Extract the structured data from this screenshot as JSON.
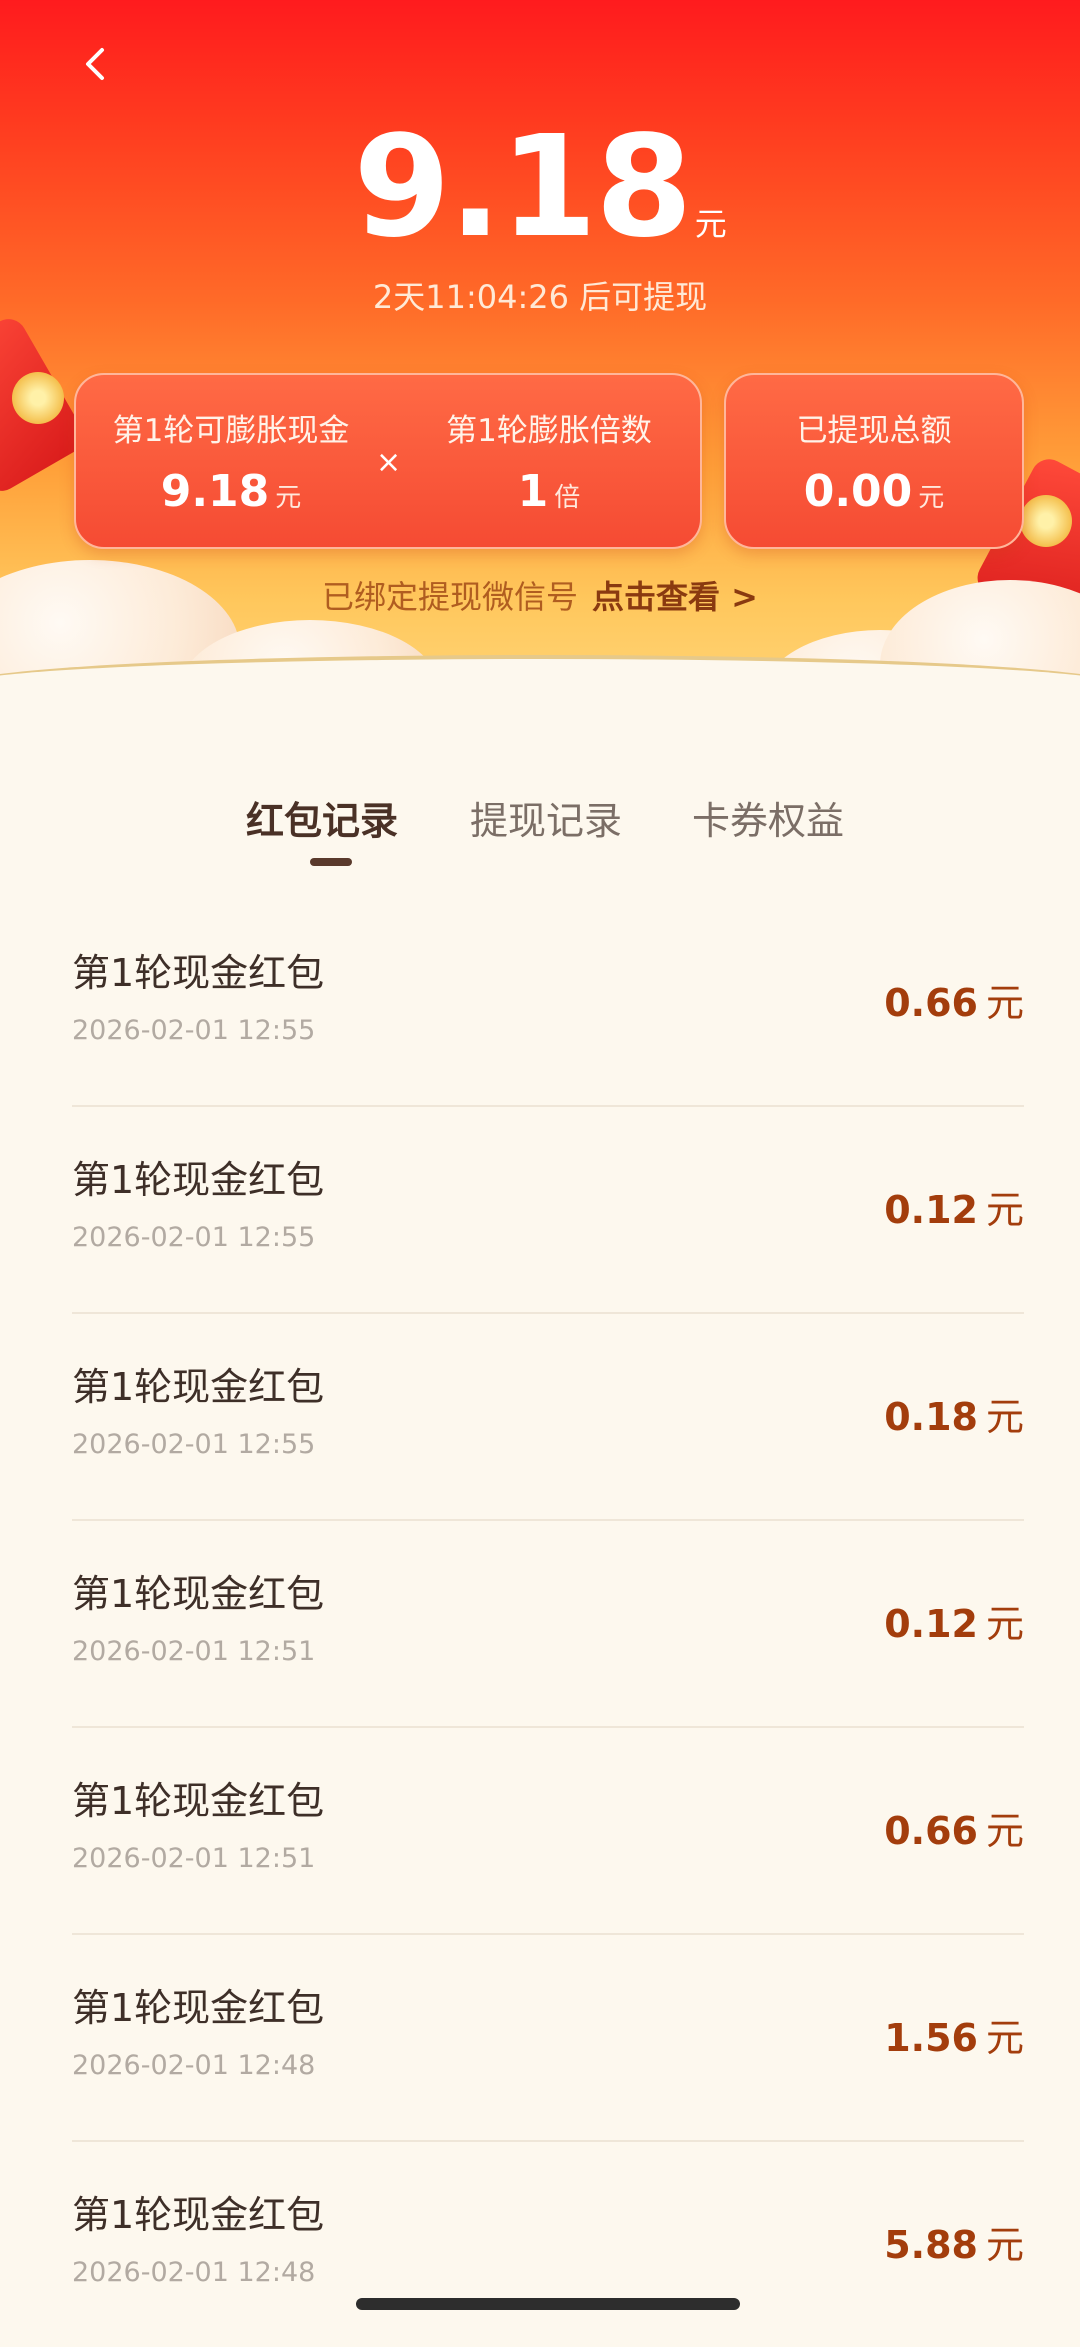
{
  "header": {
    "back_label": "返回",
    "amount": "9.18",
    "amount_unit": "元",
    "countdown": "2天11:04:26 后可提现",
    "round_cash": {
      "label": "第1轮可膨胀现金",
      "value": "9.18",
      "unit": "元"
    },
    "multiply_symbol": "×",
    "multiplier": {
      "label": "第1轮膨胀倍数",
      "value": "1",
      "unit": "倍"
    },
    "withdrawn": {
      "label": "已提现总额",
      "value": "0.00",
      "unit": "元"
    },
    "wechat_text": "已绑定提现微信号",
    "wechat_link": "点击查看 >"
  },
  "tabs": [
    {
      "label": "红包记录",
      "active": true
    },
    {
      "label": "提现记录",
      "active": false
    },
    {
      "label": "卡券权益",
      "active": false
    }
  ],
  "records": [
    {
      "title": "第1轮现金红包",
      "time": "2026-02-01 12:55",
      "amount": "0.66",
      "unit": "元"
    },
    {
      "title": "第1轮现金红包",
      "time": "2026-02-01 12:55",
      "amount": "0.12",
      "unit": "元"
    },
    {
      "title": "第1轮现金红包",
      "time": "2026-02-01 12:55",
      "amount": "0.18",
      "unit": "元"
    },
    {
      "title": "第1轮现金红包",
      "time": "2026-02-01 12:51",
      "amount": "0.12",
      "unit": "元"
    },
    {
      "title": "第1轮现金红包",
      "time": "2026-02-01 12:51",
      "amount": "0.66",
      "unit": "元"
    },
    {
      "title": "第1轮现金红包",
      "time": "2026-02-01 12:48",
      "amount": "1.56",
      "unit": "元"
    },
    {
      "title": "第1轮现金红包",
      "time": "2026-02-01 12:48",
      "amount": "5.88",
      "unit": "元"
    }
  ],
  "colors": {
    "header_top": "#ff1b1e",
    "header_bottom": "#ffd77c",
    "amount_text": "#a33d0c",
    "page_bg": "#fdf8ee"
  }
}
